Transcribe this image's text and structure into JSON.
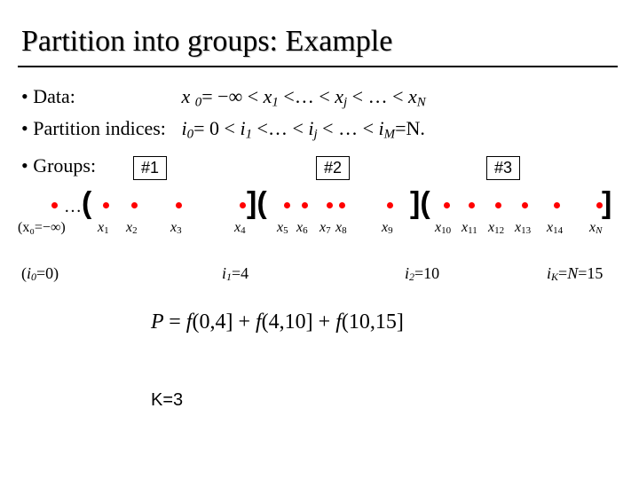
{
  "title": "Partition into groups: Example",
  "bullets": {
    "data_label": "• Data:",
    "data_expr_parts": {
      "a": "x ",
      "as": "0",
      "b": "= −∞ < ",
      "c": "x",
      "cs": "1",
      "d": " <… < ",
      "e": "x",
      "es": "j",
      "f": " < … < ",
      "g": "x",
      "gs": "N"
    },
    "pi_label": "• Partition indices:",
    "pi_expr_parts": {
      "a": "i",
      "as": "0",
      "b": "= 0 < ",
      "c": "i",
      "cs": "1",
      "d": " <… < ",
      "e": "i",
      "es": "j",
      "f": " < … < ",
      "g": "i",
      "gs": "M",
      "h": "=N."
    },
    "groups_label": "• Groups:"
  },
  "hashes": {
    "h1": "#1",
    "h2": "#2",
    "h3": "#3"
  },
  "axis": {
    "prelabel": "(x₀=−∞)",
    "ellipsis": "…",
    "open1": "(",
    "close1": "](",
    "close2": "](",
    "close3": "]",
    "xs": [
      "x₁",
      "x₂",
      "x₃",
      "x₄",
      "x₅",
      "x₆",
      "x₇",
      "x₈",
      "x₉",
      "x₁₀",
      "x₁₁",
      "x₁₂",
      "x₁₃",
      "x₁₄",
      "x_N"
    ]
  },
  "ilabels": {
    "i0": "(i₀=0)",
    "i1": "i₁=4",
    "i2": "i₂=10",
    "iK": "i_K=N=15"
  },
  "equation": "P = f(0,4] + f(4,10] + f(10,15]",
  "kline": "K=3"
}
